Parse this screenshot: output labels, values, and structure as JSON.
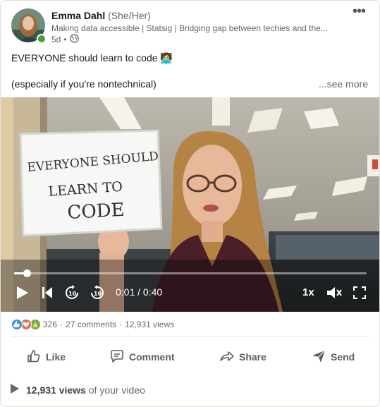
{
  "author": {
    "name": "Emma Dahl",
    "pronouns": "(She/Her)",
    "headline": "Making data accessible | Statsig | Bridging gap between techies and the...",
    "age": "5d",
    "online": true
  },
  "post": {
    "line1": "EVERYONE should learn to code 👩‍💻",
    "line2": "(especially if you're nontechnical)",
    "see_more": "...see more"
  },
  "video": {
    "whiteboard_text": "Everyone Should Learn to Code",
    "progress_fraction": 0.036,
    "current_time": "0:01",
    "duration": "0:40",
    "time_display": "0:01 / 0:40",
    "speed": "1x"
  },
  "social": {
    "reactions": [
      "like",
      "love",
      "celebrate"
    ],
    "reaction_count": "326",
    "comments": "27 comments",
    "views": "12,931 views"
  },
  "actions": {
    "like": "Like",
    "comment": "Comment",
    "share": "Share",
    "send": "Send"
  },
  "video_views": {
    "count": "12,931 views",
    "suffix": "of your video"
  },
  "colors": {
    "online": "#4a9c3b",
    "like": "#378fe9",
    "love": "#df704d",
    "celebrate": "#6dae4f"
  }
}
